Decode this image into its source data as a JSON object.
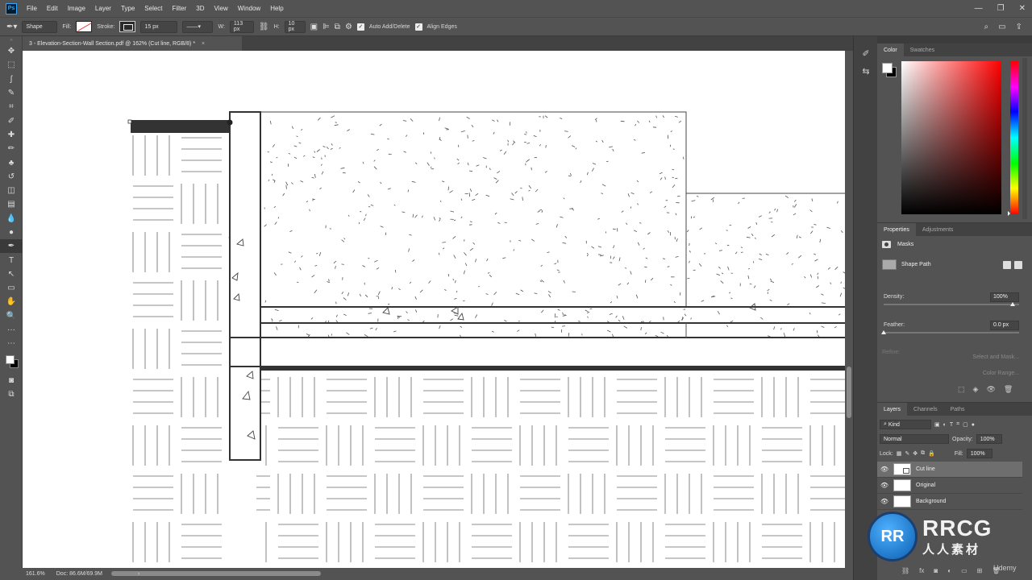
{
  "app": {
    "logo": "Ps"
  },
  "menu": [
    "File",
    "Edit",
    "Image",
    "Layer",
    "Type",
    "Select",
    "Filter",
    "3D",
    "View",
    "Window",
    "Help"
  ],
  "window_controls": [
    "—",
    "❐",
    "✕"
  ],
  "options": {
    "mode": "Shape",
    "fill_label": "Fill:",
    "stroke_label": "Stroke:",
    "stroke_width": "15 px",
    "w_label": "W:",
    "w_value": "113 px",
    "h_label": "H:",
    "h_value": "10 px",
    "auto_add_delete": "Auto Add/Delete",
    "align_edges": "Align Edges"
  },
  "document": {
    "tab_title": "3 - Elevation-Section-Wall Section.pdf @ 162% (Cut line, RGB/8) *",
    "zoom": "161.6%",
    "doc_size": "Doc: 86.6M/69.9M"
  },
  "tools": [
    "move-tool",
    "marquee-tool",
    "lasso-tool",
    "quick-select-tool",
    "crop-tool",
    "eyedropper-tool",
    "healing-tool",
    "brush-tool",
    "stamp-tool",
    "history-brush-tool",
    "eraser-tool",
    "gradient-tool",
    "blur-tool",
    "dodge-tool",
    "pen-tool",
    "type-tool",
    "path-select-tool",
    "rectangle-tool",
    "hand-tool",
    "zoom-tool",
    "more-tools"
  ],
  "tool_glyphs": [
    "✥",
    "⬚",
    "ʃ",
    "✎",
    "⌗",
    "✐",
    "✚",
    "✏",
    "♣",
    "↺",
    "◫",
    "▤",
    "💧",
    "●",
    "✒",
    "T",
    "↖",
    "▭",
    "✋",
    "🔍",
    "···"
  ],
  "active_tool": "pen-tool",
  "colors": {
    "foreground": "#ffffff",
    "background": "#000000"
  },
  "color_panel": {
    "tabs": [
      "Color",
      "Swatches"
    ],
    "active": "Color"
  },
  "properties_panel": {
    "tabs": [
      "Properties",
      "Adjustments"
    ],
    "section": "Masks",
    "shape_label": "Shape Path",
    "density_label": "Density:",
    "density_value": "100%",
    "feather_label": "Feather:",
    "feather_value": "0.0 px",
    "refine_label": "Refine:",
    "select_and_mask": "Select and Mask...",
    "color_range": "Color Range...",
    "invert": "Invert"
  },
  "layers_panel": {
    "tabs": [
      "Layers",
      "Channels",
      "Paths"
    ],
    "filter": "Kind",
    "blend_mode": "Normal",
    "opacity_label": "Opacity:",
    "opacity_value": "100%",
    "lock_label": "Lock:",
    "fill_label": "Fill:",
    "fill_value": "100%",
    "layers": [
      {
        "name": "Cut line",
        "selected": true
      },
      {
        "name": "Original",
        "selected": false
      },
      {
        "name": "Background",
        "selected": false
      }
    ]
  },
  "watermark": {
    "brand": "RRCG",
    "brand_cn": "人人素材",
    "udemy": "Udemy"
  }
}
